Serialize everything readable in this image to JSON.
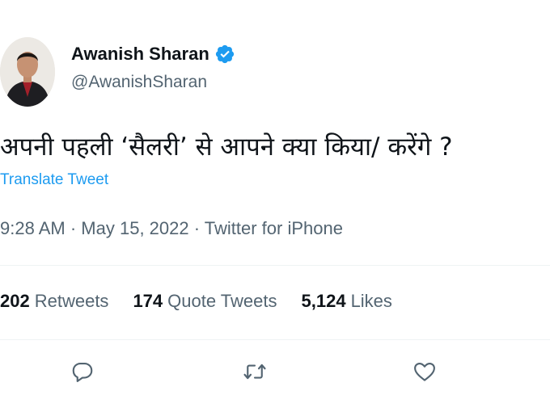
{
  "author": {
    "name": "Awanish Sharan",
    "handle": "@AwanishSharan",
    "verified_color": "#1d9bf0"
  },
  "tweet": {
    "text": "अपनी पहली ‘सैलरी’ से आपने क्या किया/ करेंगे ?",
    "translate_label": "Translate Tweet",
    "time": "9:28 AM",
    "date": "May 15, 2022",
    "source": "Twitter for iPhone",
    "separator": "·"
  },
  "stats": {
    "retweets_count": "202",
    "retweets_label": "Retweets",
    "quotes_count": "174",
    "quotes_label": "Quote Tweets",
    "likes_count": "5,124",
    "likes_label": "Likes"
  },
  "actions": {
    "reply_icon": "reply-icon",
    "retweet_icon": "retweet-icon",
    "like_icon": "heart-icon"
  }
}
